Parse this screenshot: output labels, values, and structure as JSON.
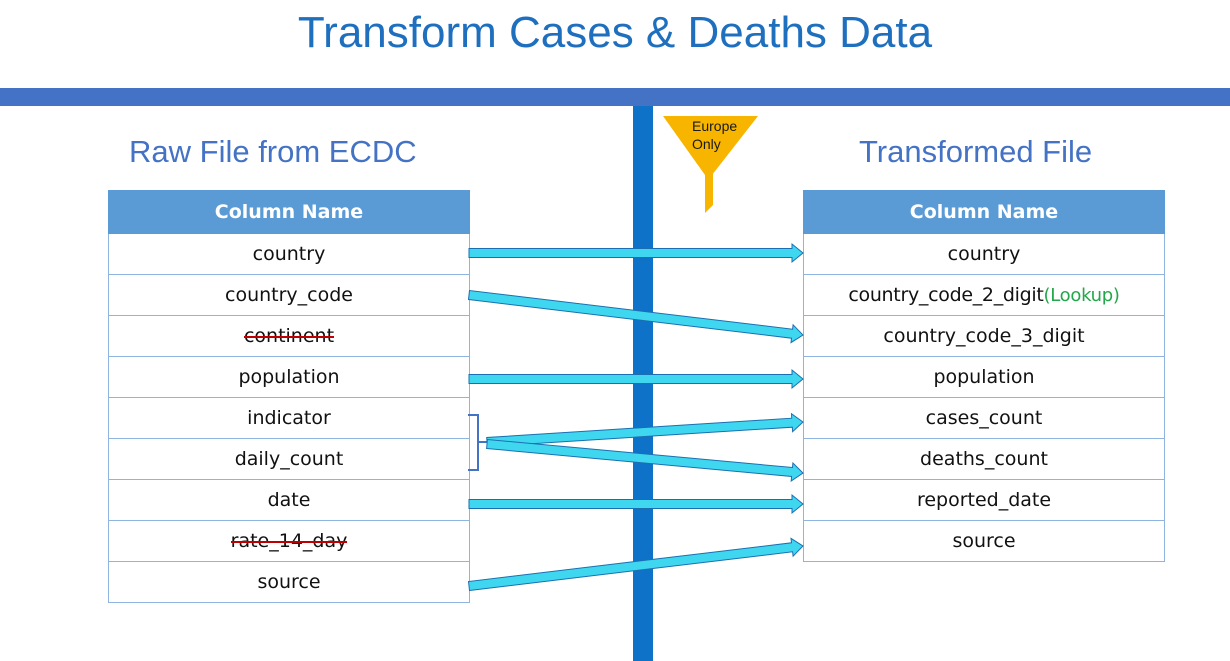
{
  "title": "Transform Cases & Deaths Data",
  "left": {
    "heading": "Raw File from ECDC",
    "column_header": "Column Name",
    "rows": [
      "country",
      "country_code",
      "continent",
      "population",
      "indicator",
      "daily_count",
      "date",
      "rate_14_day",
      "source"
    ],
    "struck_rows": [
      "continent",
      "rate_14_day"
    ]
  },
  "right": {
    "heading": "Transformed File",
    "column_header": "Column Name",
    "rows": [
      "country",
      "country_code_2_digit",
      "country_code_3_digit",
      "population",
      "cases_count",
      "deaths_count",
      "reported_date",
      "source"
    ],
    "lookup_note": "(Lookup)"
  },
  "filter": {
    "label_line1": "Europe",
    "label_line2": "Only",
    "icon": "funnel-icon"
  },
  "colors": {
    "title": "#1f6fbf",
    "bar": "#4472c4",
    "divider": "#0e72c8",
    "header": "#5b9bd5",
    "arrow_fill": "#3fd7ef",
    "arrow_stroke": "#1b6fb0",
    "funnel": "#f7b500",
    "strike": "#c00000",
    "lookup": "#22a84a"
  }
}
